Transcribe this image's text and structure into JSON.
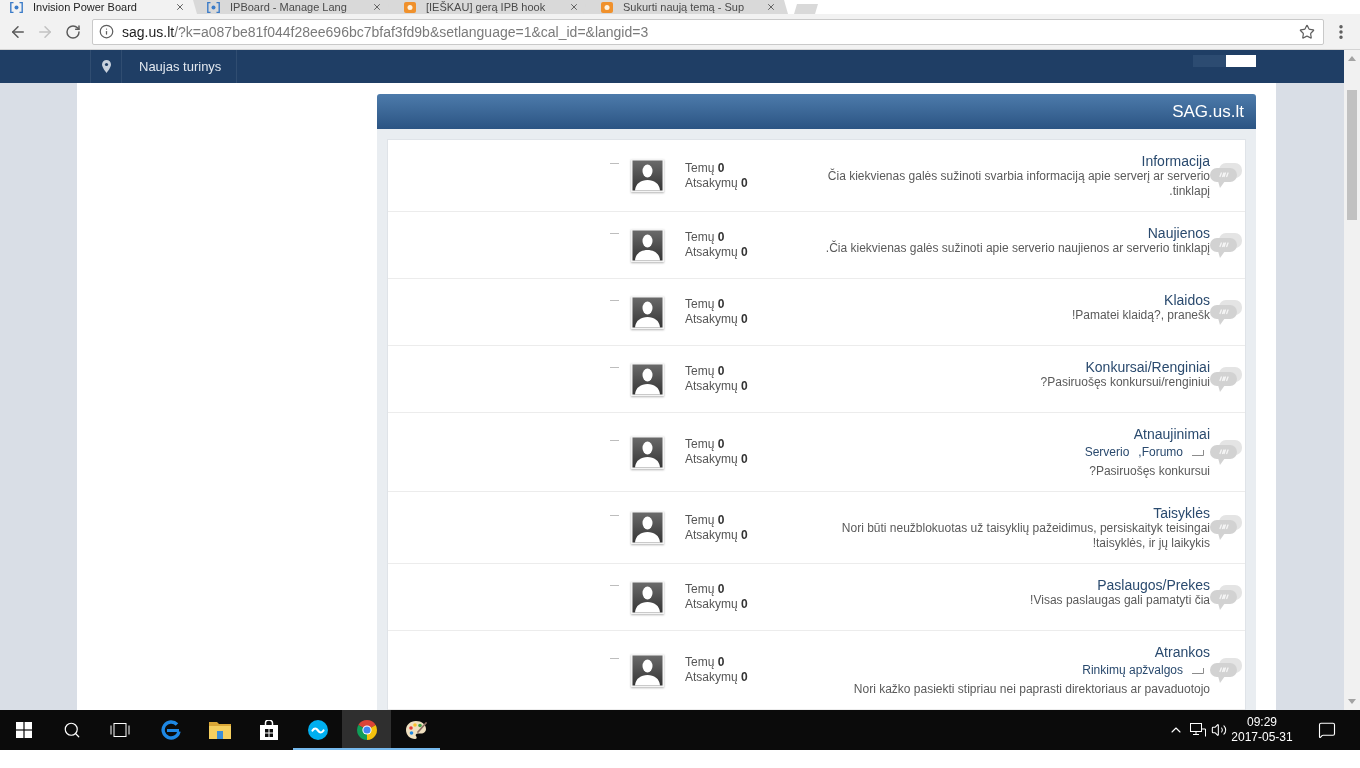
{
  "browser": {
    "tabs": [
      {
        "title": "Invision Power Board",
        "kind": "brackets",
        "selected": true
      },
      {
        "title": "IPBoard - Manage Lang",
        "kind": "brackets",
        "selected": false
      },
      {
        "title": "[IEŠKAU] gerą IPB hook",
        "kind": "badge",
        "selected": false
      },
      {
        "title": "Sukurti naują temą - Sup",
        "kind": "badge",
        "selected": false
      }
    ],
    "navigation": {
      "back": {
        "disabled": false
      },
      "forward": {
        "disabled": true
      }
    },
    "address_bar": {
      "host": "sag.us.lt",
      "path": "/?k=a087be81f044f28ee696bc7bfaf3fd9b&setlanguage=1&cal_id=&langid=3"
    }
  },
  "nav_bar": {
    "items": [
      {
        "label": "Naujas turinys"
      }
    ]
  },
  "category": {
    "title": "SAG.us.lt",
    "forums": [
      {
        "title": "Informacija",
        "description": "Čia kiekvienas galės sužinoti svarbia informaciją apie serverį ar serverio .tinklapį",
        "topics": "Temų **0**",
        "replies": "Atsakymų **0**",
        "last_post": "—"
      },
      {
        "title": "Naujienos",
        "description": ".Čia kiekvienas galės sužinoti apie serverio naujienos ar serverio tinklapį",
        "topics": "Temų **0**",
        "replies": "Atsakymų **0**",
        "last_post": "—"
      },
      {
        "title": "Klaidos",
        "description": "!Pamatei klaidą?, pranešk",
        "topics": "Temų **0**",
        "replies": "Atsakymų **0**",
        "last_post": "—"
      },
      {
        "title": "Konkursai/Renginiai",
        "description": "?Pasiruošęs konkursui/renginiui",
        "topics": "Temų **0**",
        "replies": "Atsakymų **0**",
        "last_post": "—"
      },
      {
        "title": "Atnaujinimai",
        "subforums": [
          {
            "label": "Serverio"
          },
          {
            "label": ",Forumo"
          }
        ],
        "description": "?Pasiruošęs konkursui",
        "topics": "Temų **0**",
        "replies": "Atsakymų **0**",
        "last_post": "—"
      },
      {
        "title": "Taisyklės",
        "description": "Nori būti neužblokuotas už taisyklių pažeidimus, persiskaityk teisingai !taisyklės, ir jų laikykis",
        "topics": "Temų **0**",
        "replies": "Atsakymų **0**",
        "last_post": "—"
      },
      {
        "title": "Paslaugos/Prekes",
        "description": "!Visas paslaugas gali pamatyti čia",
        "topics": "Temų **0**",
        "replies": "Atsakymų **0**",
        "last_post": "—"
      },
      {
        "title": "Atrankos",
        "subforums": [
          {
            "label": "Rinkimų apžvalgos"
          }
        ],
        "description": "Nori kažko pasiekti stipriau nei paprasti direktoriaus ar pavaduotojo",
        "topics": "Temų **0**",
        "replies": "Atsakymų **0**",
        "last_post": "—"
      }
    ]
  },
  "taskbar": {
    "apps": [
      {
        "kind": "swirl",
        "running": false,
        "active": false
      },
      {
        "kind": "folder",
        "running": false,
        "active": false
      },
      {
        "kind": "bag",
        "running": false,
        "active": false
      },
      {
        "kind": "chat",
        "running": true,
        "active": false
      },
      {
        "kind": "wheel",
        "running": true,
        "active": true
      },
      {
        "kind": "palette",
        "running": true,
        "active": false
      }
    ],
    "clock": {
      "time": "09:29",
      "date": "2017-05-31"
    }
  }
}
